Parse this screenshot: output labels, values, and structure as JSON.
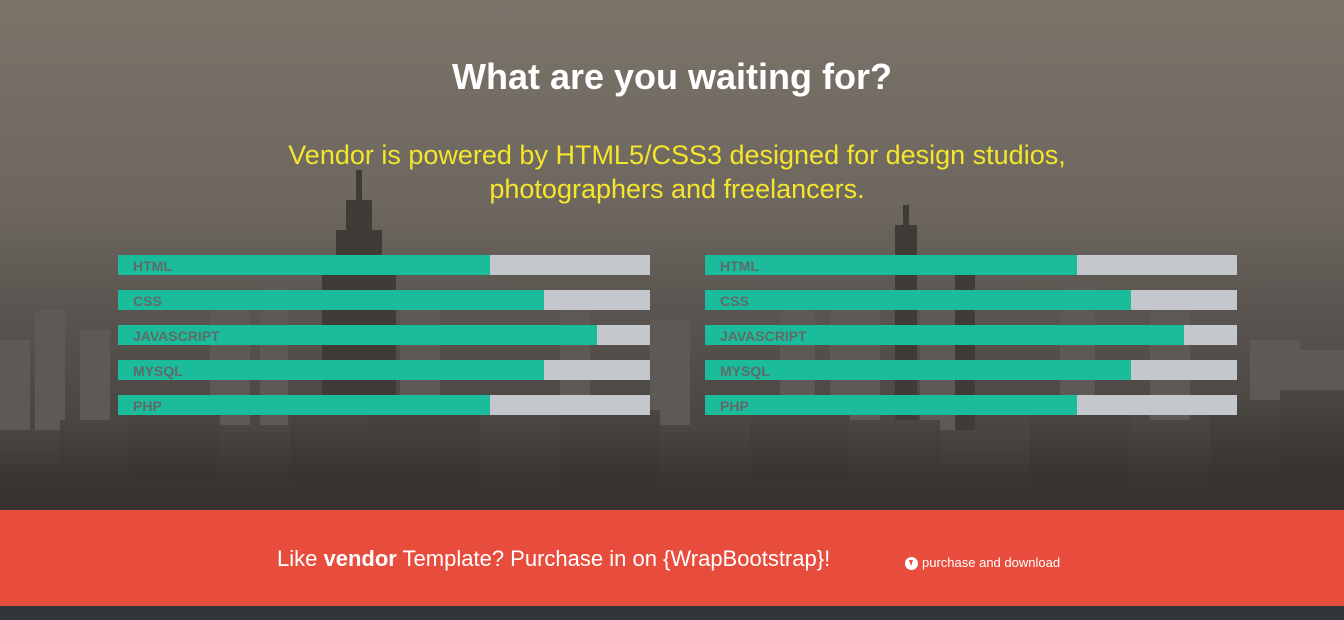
{
  "hero": {
    "title": "What are you waiting for?",
    "subtitle_line1": "Vendor is powered by HTML5/CSS3 designed for design studios,",
    "subtitle_line2": "photographers and freelancers."
  },
  "skills_left": [
    {
      "label": "HTML",
      "percent": 70
    },
    {
      "label": "CSS",
      "percent": 80
    },
    {
      "label": "JAVASCRIPT",
      "percent": 90
    },
    {
      "label": "MYSQL",
      "percent": 80
    },
    {
      "label": "PHP",
      "percent": 70
    }
  ],
  "skills_right": [
    {
      "label": "HTML",
      "percent": 70
    },
    {
      "label": "CSS",
      "percent": 80
    },
    {
      "label": "JAVASCRIPT",
      "percent": 90
    },
    {
      "label": "MYSQL",
      "percent": 80
    },
    {
      "label": "PHP",
      "percent": 70
    }
  ],
  "cta": {
    "text_pre": "Like ",
    "text_bold": "vendor",
    "text_post": " Template? Purchase in on {WrapBootstrap}!",
    "link_label": "purchase and download",
    "link_icon": "download-circle-icon"
  },
  "colors": {
    "accent_fill": "#1bbc9b",
    "bar_track": "#c4c8cc",
    "cta_bg": "#e74c3c",
    "subtitle": "#f5e52c"
  }
}
